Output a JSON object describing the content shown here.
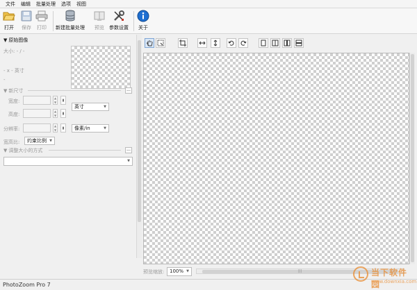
{
  "menu": [
    "文件",
    "编辑",
    "批量处理",
    "选项",
    "视图"
  ],
  "toolbar": {
    "open": "打开",
    "save": "保存",
    "print": "打印",
    "batch": "新建批量处理",
    "preview": "预览",
    "settings": "参数设置",
    "about": "关于"
  },
  "original": {
    "title": "原始图像",
    "size_text": "大小: - / -",
    "dims_text": "- x - 英寸",
    "dash_text": "-"
  },
  "newsize": {
    "title": "新尺寸",
    "width_label": "宽度:",
    "height_label": "高度:",
    "resolution_label": "分辨率:",
    "unit_value": "英寸",
    "resolution_unit_value": "像素/in",
    "aspect_label": "宽高比:",
    "aspect_value": "约束比例",
    "more_button": "..."
  },
  "resize": {
    "title": "调整大小的方式",
    "method_value": "",
    "more_button": "..."
  },
  "zoom": {
    "label": "预览缩放:",
    "value": "100%"
  },
  "status": {
    "app_name": "PhotoZoom Pro 7"
  },
  "watermark": {
    "cn": "当下软件园",
    "url": "www.downxia.com"
  },
  "colors": {
    "info_blue": "#1f6fd1",
    "folder_yellow": "#f0c24a",
    "active_tool": "#dbe8f7"
  }
}
